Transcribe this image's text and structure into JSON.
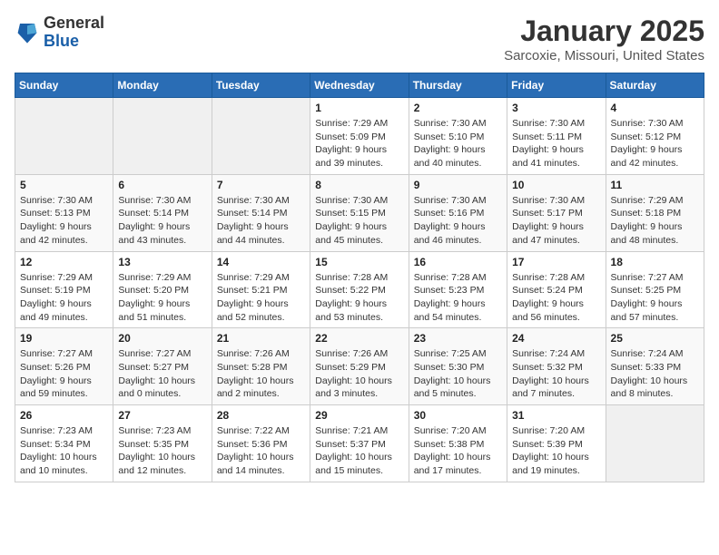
{
  "header": {
    "logo": {
      "general": "General",
      "blue": "Blue"
    },
    "title": "January 2025",
    "subtitle": "Sarcoxie, Missouri, United States"
  },
  "weekdays": [
    "Sunday",
    "Monday",
    "Tuesday",
    "Wednesday",
    "Thursday",
    "Friday",
    "Saturday"
  ],
  "weeks": [
    [
      {
        "day": "",
        "info": ""
      },
      {
        "day": "",
        "info": ""
      },
      {
        "day": "",
        "info": ""
      },
      {
        "day": "1",
        "info": "Sunrise: 7:29 AM\nSunset: 5:09 PM\nDaylight: 9 hours\nand 39 minutes."
      },
      {
        "day": "2",
        "info": "Sunrise: 7:30 AM\nSunset: 5:10 PM\nDaylight: 9 hours\nand 40 minutes."
      },
      {
        "day": "3",
        "info": "Sunrise: 7:30 AM\nSunset: 5:11 PM\nDaylight: 9 hours\nand 41 minutes."
      },
      {
        "day": "4",
        "info": "Sunrise: 7:30 AM\nSunset: 5:12 PM\nDaylight: 9 hours\nand 42 minutes."
      }
    ],
    [
      {
        "day": "5",
        "info": "Sunrise: 7:30 AM\nSunset: 5:13 PM\nDaylight: 9 hours\nand 42 minutes."
      },
      {
        "day": "6",
        "info": "Sunrise: 7:30 AM\nSunset: 5:14 PM\nDaylight: 9 hours\nand 43 minutes."
      },
      {
        "day": "7",
        "info": "Sunrise: 7:30 AM\nSunset: 5:14 PM\nDaylight: 9 hours\nand 44 minutes."
      },
      {
        "day": "8",
        "info": "Sunrise: 7:30 AM\nSunset: 5:15 PM\nDaylight: 9 hours\nand 45 minutes."
      },
      {
        "day": "9",
        "info": "Sunrise: 7:30 AM\nSunset: 5:16 PM\nDaylight: 9 hours\nand 46 minutes."
      },
      {
        "day": "10",
        "info": "Sunrise: 7:30 AM\nSunset: 5:17 PM\nDaylight: 9 hours\nand 47 minutes."
      },
      {
        "day": "11",
        "info": "Sunrise: 7:29 AM\nSunset: 5:18 PM\nDaylight: 9 hours\nand 48 minutes."
      }
    ],
    [
      {
        "day": "12",
        "info": "Sunrise: 7:29 AM\nSunset: 5:19 PM\nDaylight: 9 hours\nand 49 minutes."
      },
      {
        "day": "13",
        "info": "Sunrise: 7:29 AM\nSunset: 5:20 PM\nDaylight: 9 hours\nand 51 minutes."
      },
      {
        "day": "14",
        "info": "Sunrise: 7:29 AM\nSunset: 5:21 PM\nDaylight: 9 hours\nand 52 minutes."
      },
      {
        "day": "15",
        "info": "Sunrise: 7:28 AM\nSunset: 5:22 PM\nDaylight: 9 hours\nand 53 minutes."
      },
      {
        "day": "16",
        "info": "Sunrise: 7:28 AM\nSunset: 5:23 PM\nDaylight: 9 hours\nand 54 minutes."
      },
      {
        "day": "17",
        "info": "Sunrise: 7:28 AM\nSunset: 5:24 PM\nDaylight: 9 hours\nand 56 minutes."
      },
      {
        "day": "18",
        "info": "Sunrise: 7:27 AM\nSunset: 5:25 PM\nDaylight: 9 hours\nand 57 minutes."
      }
    ],
    [
      {
        "day": "19",
        "info": "Sunrise: 7:27 AM\nSunset: 5:26 PM\nDaylight: 9 hours\nand 59 minutes."
      },
      {
        "day": "20",
        "info": "Sunrise: 7:27 AM\nSunset: 5:27 PM\nDaylight: 10 hours\nand 0 minutes."
      },
      {
        "day": "21",
        "info": "Sunrise: 7:26 AM\nSunset: 5:28 PM\nDaylight: 10 hours\nand 2 minutes."
      },
      {
        "day": "22",
        "info": "Sunrise: 7:26 AM\nSunset: 5:29 PM\nDaylight: 10 hours\nand 3 minutes."
      },
      {
        "day": "23",
        "info": "Sunrise: 7:25 AM\nSunset: 5:30 PM\nDaylight: 10 hours\nand 5 minutes."
      },
      {
        "day": "24",
        "info": "Sunrise: 7:24 AM\nSunset: 5:32 PM\nDaylight: 10 hours\nand 7 minutes."
      },
      {
        "day": "25",
        "info": "Sunrise: 7:24 AM\nSunset: 5:33 PM\nDaylight: 10 hours\nand 8 minutes."
      }
    ],
    [
      {
        "day": "26",
        "info": "Sunrise: 7:23 AM\nSunset: 5:34 PM\nDaylight: 10 hours\nand 10 minutes."
      },
      {
        "day": "27",
        "info": "Sunrise: 7:23 AM\nSunset: 5:35 PM\nDaylight: 10 hours\nand 12 minutes."
      },
      {
        "day": "28",
        "info": "Sunrise: 7:22 AM\nSunset: 5:36 PM\nDaylight: 10 hours\nand 14 minutes."
      },
      {
        "day": "29",
        "info": "Sunrise: 7:21 AM\nSunset: 5:37 PM\nDaylight: 10 hours\nand 15 minutes."
      },
      {
        "day": "30",
        "info": "Sunrise: 7:20 AM\nSunset: 5:38 PM\nDaylight: 10 hours\nand 17 minutes."
      },
      {
        "day": "31",
        "info": "Sunrise: 7:20 AM\nSunset: 5:39 PM\nDaylight: 10 hours\nand 19 minutes."
      },
      {
        "day": "",
        "info": ""
      }
    ]
  ]
}
